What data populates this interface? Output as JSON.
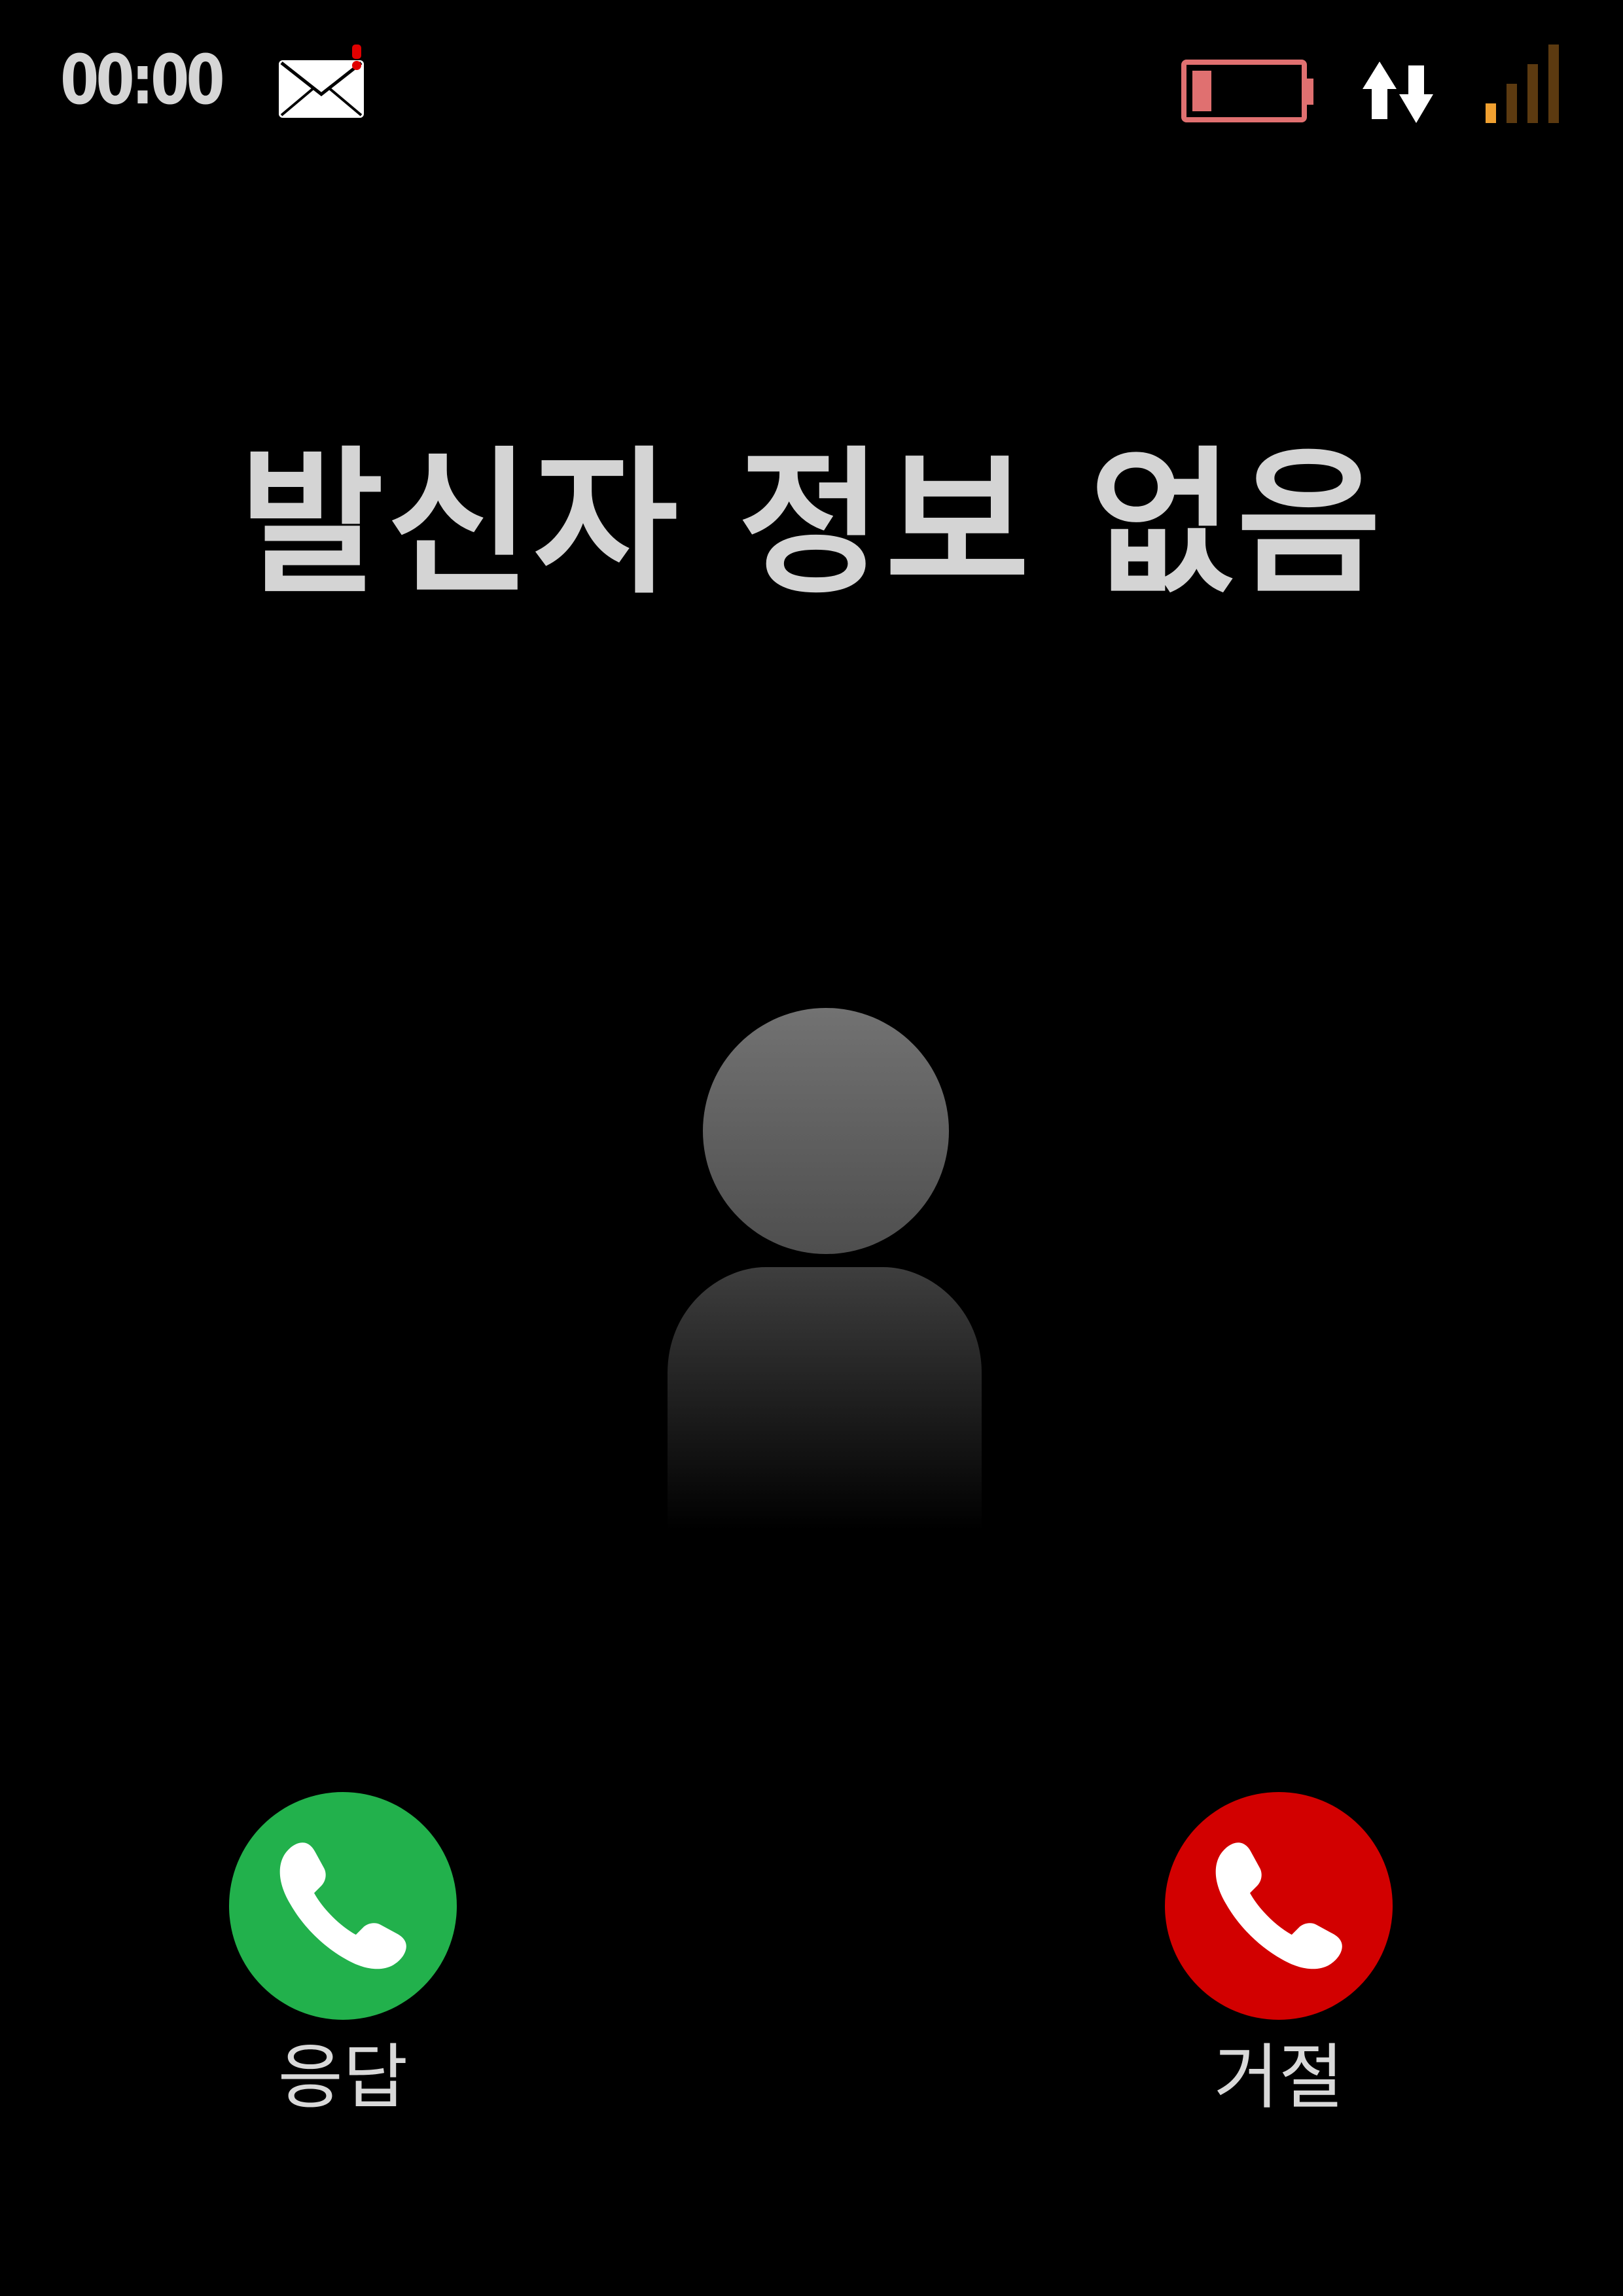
{
  "status_bar": {
    "time": "00:00",
    "icons": [
      "mail-notification-icon",
      "battery-low-icon",
      "data-transfer-icon",
      "signal-strength-icon"
    ],
    "battery_level": 0.18,
    "signal_bars_active": 1,
    "signal_bars_total": 4
  },
  "caller": {
    "name": "발신자 정보 없음",
    "avatar_icon": "person-silhouette-icon"
  },
  "actions": {
    "answer_label": "응답",
    "decline_label": "거절"
  },
  "colors": {
    "background": "#000000",
    "answer": "#22b14c",
    "decline": "#d20000",
    "battery_outline": "#e07070",
    "signal_active": "#f0a030",
    "signal_inactive": "#5c3a10",
    "text": "#d4d4d4"
  }
}
